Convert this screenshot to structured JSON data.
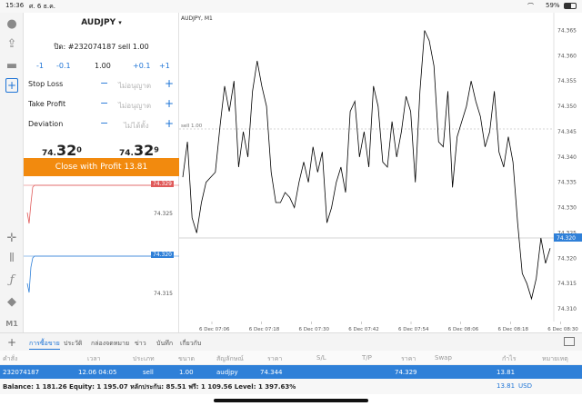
{
  "status": {
    "time": "15:36",
    "date": "ศ. 6 ธ.ค.",
    "battery": "59%",
    "wifi": "wifi-icon",
    "battery_icon": "battery-icon"
  },
  "toolbar": {
    "icons": [
      "person-icon",
      "share-icon",
      "chat-icon",
      "new-order-icon",
      "crosshair-icon",
      "candles-icon",
      "function-icon",
      "objects-icon"
    ],
    "timeframe": "M1"
  },
  "order": {
    "symbol": "AUDJPY",
    "symbol_caret": "▾",
    "title": "ปิด: #232074187 sell 1.00",
    "volume": "1.00",
    "vol_steps": [
      "-1",
      "-0.1",
      "+0.1",
      "+1"
    ],
    "stop_loss": {
      "label": "Stop Loss",
      "value": "ไม่อนุญาต"
    },
    "take_profit": {
      "label": "Take Profit",
      "value": "ไม่อนุญาต"
    },
    "deviation": {
      "label": "Deviation",
      "value": "ไม่ได้ตั้ง"
    },
    "bid": {
      "small": "74.",
      "big": "32",
      "sup": "0"
    },
    "ask": {
      "small": "74.",
      "big": "32",
      "sup": "9"
    },
    "close_button": "Close with Profit 13.81"
  },
  "mini_chart": {
    "ask_label": "74.329",
    "bid_label": "74.320",
    "tick_1": "74.325",
    "tick_2": "74.315",
    "ask_color": "#e05a5a",
    "bid_color": "#2f80d8"
  },
  "chart": {
    "title": "AUDJPY, M1",
    "sl_label": "sell 1.00",
    "current_price": "74.320",
    "current_price_color": "#2f80d8",
    "y_ticks": [
      "74.365",
      "74.360",
      "74.355",
      "74.350",
      "74.345",
      "74.340",
      "74.335",
      "74.330",
      "74.325",
      "74.320",
      "74.315",
      "74.310"
    ],
    "x_ticks": [
      "6 Dec 07:06",
      "6 Dec 07:18",
      "6 Dec 07:30",
      "6 Dec 07:42",
      "6 Dec 07:54",
      "6 Dec 08:06",
      "6 Dec 08:18",
      "6 Dec 08:30"
    ]
  },
  "chart_data": {
    "type": "line",
    "title": "AUDJPY, M1",
    "xlabel": "",
    "ylabel": "",
    "ylim": [
      74.3075,
      74.3685
    ],
    "series": [
      {
        "values": [
          74.336,
          74.343,
          74.328,
          74.325,
          74.331,
          74.335,
          74.336,
          74.337,
          74.346,
          74.354,
          74.349,
          74.355,
          74.338,
          74.345,
          74.34,
          74.353,
          74.359,
          74.354,
          74.35,
          74.337,
          74.331,
          74.331,
          74.333,
          74.332,
          74.33,
          74.335,
          74.339,
          74.335,
          74.342,
          74.337,
          74.341,
          74.327,
          74.33,
          74.335,
          74.338,
          74.333,
          74.349,
          74.351,
          74.34,
          74.345,
          74.338,
          74.354,
          74.35,
          74.339,
          74.338,
          74.347,
          74.34,
          74.345,
          74.352,
          74.349,
          74.335,
          74.353,
          74.365,
          74.363,
          74.358,
          74.343,
          74.342,
          74.353,
          74.334,
          74.344,
          74.347,
          74.35,
          74.355,
          74.351,
          74.348,
          74.342,
          74.345,
          74.353,
          74.341,
          74.338,
          74.344,
          74.339,
          74.327,
          74.317,
          74.315,
          74.312,
          74.316,
          74.324,
          74.319,
          74.322
        ]
      }
    ]
  },
  "tabs": {
    "add": "+",
    "items": [
      "การซื้อขาย",
      "ประวัติ",
      "กล่องจดหมาย",
      "ข่าว",
      "บันทึก",
      "เกี่ยวกับ"
    ],
    "right_icon": "layout-icon"
  },
  "columns": [
    "คำสั่ง",
    "เวลา",
    "ประเภท",
    "ขนาด",
    "สัญลักษณ์",
    "ราคา",
    "S/L",
    "T/P",
    "ราคา",
    "Swap",
    "กำไร",
    "หมายเหตุ"
  ],
  "position": [
    "232074187",
    "12.06 04:05",
    "sell",
    "1.00",
    "audjpy",
    "74.344",
    "",
    "",
    "74.329",
    "",
    "13.81",
    ""
  ],
  "balance": {
    "text": "Balance: 1 181.26 Equity: 1 195.07 หลักประกัน: 85.51 ฟรี: 1 109.56 Level: 1 397.63%",
    "profit": "13.81",
    "currency": "USD"
  }
}
